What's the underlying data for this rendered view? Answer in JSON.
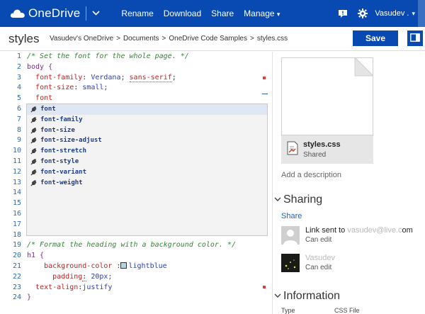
{
  "topbar": {
    "brand": "OneDrive",
    "commands": [
      "Rename",
      "Download",
      "Share",
      "Manage"
    ],
    "user": "Vasudev ."
  },
  "header": {
    "title": "styles",
    "breadcrumb": [
      "Vasudev's OneDrive",
      "Documents",
      "OneDrive Code Samples",
      "styles.css"
    ],
    "save_label": "Save"
  },
  "editor": {
    "line_numbers": [
      "1",
      "2",
      "3",
      "4",
      "5",
      "6",
      "7",
      "8",
      "9",
      "10",
      "11",
      "12",
      "13",
      "14",
      "15",
      "16",
      "17",
      "18",
      "19",
      "20",
      "21",
      "22",
      "23",
      "24"
    ],
    "code": {
      "l1": "/* Set the font for the whole page. */",
      "l2": "body {",
      "l3_prop": "font-family",
      "l3_val": "Verdana;",
      "l3_val2": "sans-serif",
      "l3_end": ";",
      "l4_prop": "font-size",
      "l4_val": "small;",
      "l5_partial": "font",
      "l19": "/* Format the heading with a background color. */",
      "l20": "h1 {",
      "l21_prop": "background-color",
      "l21_val": "lightblue",
      "l22_prop": "padding",
      "l22_val": "20px;",
      "l23_prop": "text-align",
      "l23_val": "justify",
      "l24": "}"
    },
    "suggestions": [
      "font",
      "font-family",
      "font-size",
      "font-size-adjust",
      "font-stretch",
      "font-style",
      "font-variant",
      "font-weight"
    ]
  },
  "side": {
    "file_name": "styles.css",
    "file_status": "Shared",
    "add_description": "Add a description",
    "sharing_title": "Sharing",
    "share_link": "Share",
    "people": [
      {
        "name_prefix": "Link sent to",
        "name_hidden": "vasudev@live.c",
        "name_suffix": "om",
        "permission": "Can edit"
      },
      {
        "name_prefix": "",
        "name_hidden": "Vasudev",
        "name_suffix": "",
        "permission": "Can edit"
      }
    ],
    "information_title": "Information",
    "info_type_label": "Type",
    "info_type_value": "CSS File"
  },
  "colors": {
    "brand_blue": "#094ab2",
    "comment_green": "#2d8a2d",
    "keyword_blue": "#2b40b5",
    "property_red": "#c02020"
  },
  "icons": [
    "onedrive-cloud-icon",
    "chevron-down-icon",
    "feedback-icon",
    "gear-icon",
    "pane-toggle-icon",
    "wrench-icon",
    "css-file-icon",
    "chevron-down-icon"
  ]
}
